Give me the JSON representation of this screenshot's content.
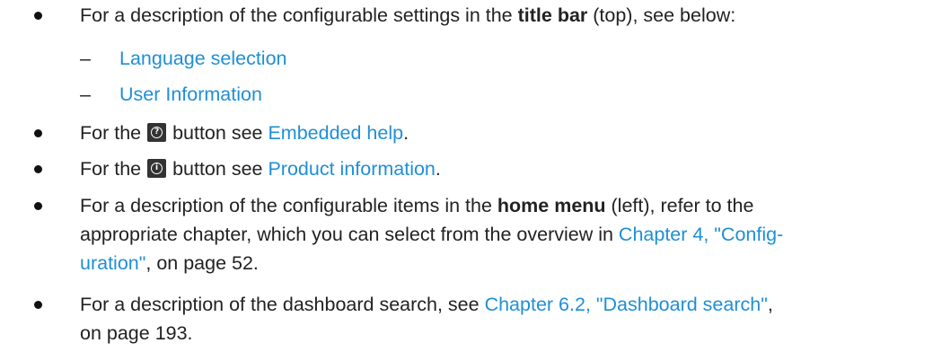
{
  "items": [
    {
      "prefix": "For a description of the configurable settings in the ",
      "bold": "title bar",
      "suffix": " (top), see below:"
    },
    {
      "prefix": "For the ",
      "icon": "help-circle-icon",
      "icon_glyph": "?",
      "middle": " button see ",
      "link": "Embedded help",
      "suffix": "."
    },
    {
      "prefix": "For the ",
      "icon": "info-circle-icon",
      "icon_glyph": "i",
      "middle": " button see ",
      "link": "Product information",
      "suffix": "."
    },
    {
      "line1_prefix": "For a description of the configurable items in the ",
      "bold": "home menu",
      "line1_suffix": " (left), refer to the",
      "line2": "appropriate chapter, which you can select from the overview in ",
      "link_part1": "Chapter 4, \"Config-",
      "link_part2": "uration\"",
      "suffix": ", on page 52."
    },
    {
      "prefix": "For a description of the dashboard search, see ",
      "link": "Chapter 6.2, \"Dashboard search\"",
      "middle": ",",
      "line2": "on page 193."
    }
  ],
  "subitems": [
    {
      "dash": "–",
      "link": "Language selection"
    },
    {
      "dash": "–",
      "link": "User Information"
    }
  ]
}
